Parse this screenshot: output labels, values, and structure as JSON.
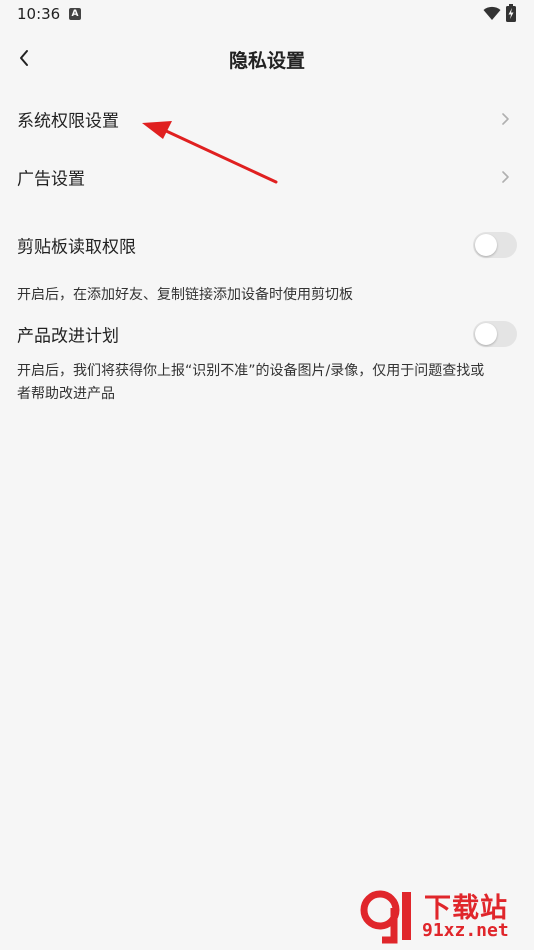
{
  "status_bar": {
    "time": "10:36",
    "app_icon_letter": "A"
  },
  "header": {
    "title": "隐私设置"
  },
  "rows": {
    "system_permission": {
      "label": "系统权限设置"
    },
    "ad_settings": {
      "label": "广告设置"
    },
    "clipboard": {
      "label": "剪贴板读取权限",
      "enabled": false,
      "description": "开启后，在添加好友、复制链接添加设备时使用剪切板"
    },
    "improvement": {
      "label": "产品改进计划",
      "enabled": false,
      "description": "开启后，我们将获得你上报“识别不准”的设备图片/录像，仅用于问题查找或者帮助改进产品"
    }
  },
  "watermark": {
    "title": "下载站",
    "domain": "91xz.net"
  },
  "colors": {
    "background": "#f6f6f6",
    "annotation_arrow": "#e02020",
    "watermark": "#e0262b",
    "toggle_off": "#e4e4e4"
  }
}
